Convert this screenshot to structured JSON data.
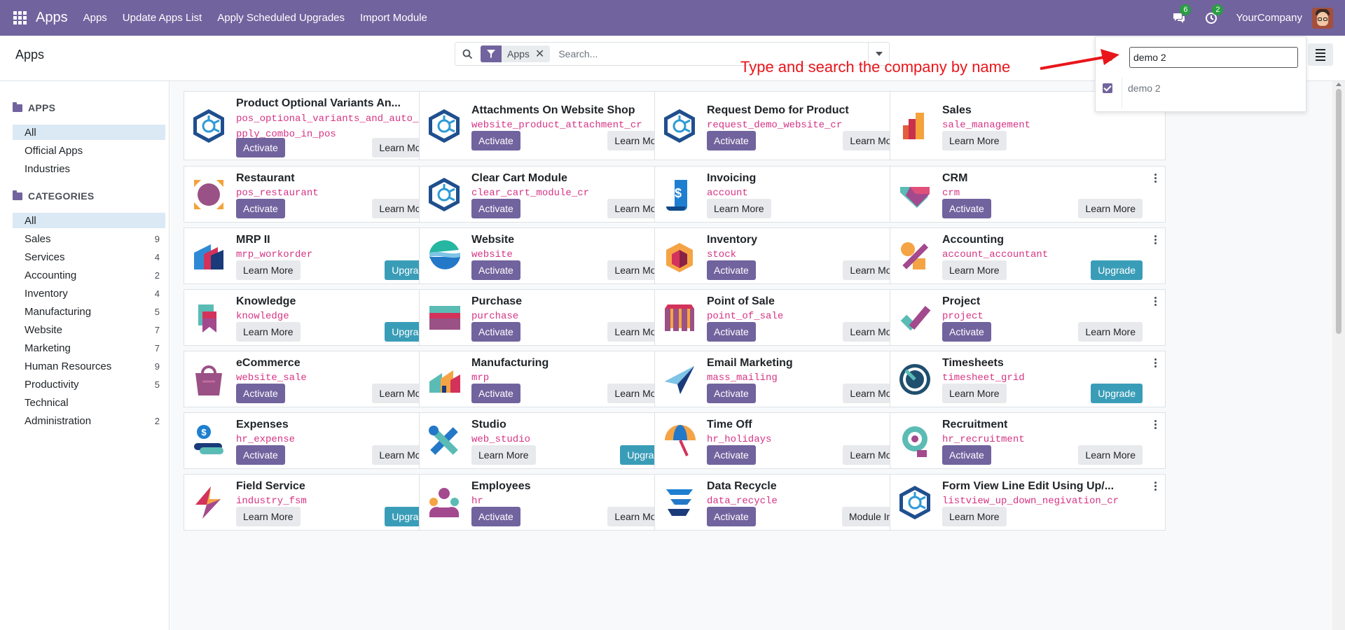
{
  "navbar": {
    "brand": "Apps",
    "menus": [
      "Apps",
      "Update Apps List",
      "Apply Scheduled Upgrades",
      "Import Module"
    ],
    "messages_badge": "6",
    "activities_badge": "2",
    "company": "YourCompany",
    "bg_color": "#71639e"
  },
  "control_panel": {
    "title": "Apps",
    "facet_label": "Apps",
    "search_placeholder": "Search..."
  },
  "company_switcher": {
    "search_value": "demo 2",
    "option": "demo 2",
    "option_checked": true
  },
  "annotation": {
    "text": "Type and search the company by name",
    "color": "#e8161b"
  },
  "sidebar": {
    "apps_header": "APPS",
    "apps_items": [
      {
        "label": "All",
        "active": true
      },
      {
        "label": "Official Apps",
        "active": false
      },
      {
        "label": "Industries",
        "active": false
      }
    ],
    "categories_header": "CATEGORIES",
    "categories": [
      {
        "label": "All",
        "count": "",
        "active": true
      },
      {
        "label": "Sales",
        "count": "9"
      },
      {
        "label": "Services",
        "count": "4"
      },
      {
        "label": "Accounting",
        "count": "2"
      },
      {
        "label": "Inventory",
        "count": "4"
      },
      {
        "label": "Manufacturing",
        "count": "5"
      },
      {
        "label": "Website",
        "count": "7"
      },
      {
        "label": "Marketing",
        "count": "7"
      },
      {
        "label": "Human Resources",
        "count": "9"
      },
      {
        "label": "Productivity",
        "count": "5"
      },
      {
        "label": "Technical",
        "count": ""
      },
      {
        "label": "Administration",
        "count": "2"
      }
    ]
  },
  "apps": [
    {
      "name": "Product Optional Variants An...",
      "tech": "pos_optional_variants_and_auto_apply_combo_in_pos",
      "tech_lines": [
        "pos_optional_variants_and_auto_a",
        "pply_combo_in_pos"
      ],
      "icon": "cybrosys-icon",
      "buttons": [
        "Activate",
        "Learn More"
      ]
    },
    {
      "name": "Attachments On Website Shop",
      "tech": "website_product_attachment_cr",
      "icon": "cybrosys-icon",
      "buttons": [
        "Activate",
        "Learn More"
      ]
    },
    {
      "name": "Request Demo for Product",
      "tech": "request_demo_website_cr",
      "icon": "cybrosys-icon",
      "buttons": [
        "Activate",
        "Learn More"
      ]
    },
    {
      "name": "Sales",
      "tech": "sale_management",
      "icon": "sales-icon",
      "buttons": [
        "Learn More"
      ]
    },
    {
      "name": "Restaurant",
      "tech": "pos_restaurant",
      "icon": "restaurant-icon",
      "buttons": [
        "Activate",
        "Learn More"
      ]
    },
    {
      "name": "Clear Cart Module",
      "tech": "clear_cart_module_cr",
      "icon": "cybrosys-icon",
      "buttons": [
        "Activate",
        "Learn More"
      ]
    },
    {
      "name": "Invoicing",
      "tech": "account",
      "icon": "invoicing-icon",
      "buttons": [
        "Learn More"
      ]
    },
    {
      "name": "CRM",
      "tech": "crm",
      "icon": "crm-icon",
      "buttons": [
        "Activate",
        "Learn More"
      ]
    },
    {
      "name": "MRP II",
      "tech": "mrp_workorder",
      "icon": "mrp-icon",
      "buttons": [
        "Learn More",
        "Upgrade"
      ]
    },
    {
      "name": "Website",
      "tech": "website",
      "icon": "website-icon",
      "buttons": [
        "Activate",
        "Learn More"
      ]
    },
    {
      "name": "Inventory",
      "tech": "stock",
      "icon": "inventory-icon",
      "buttons": [
        "Activate",
        "Learn More"
      ]
    },
    {
      "name": "Accounting",
      "tech": "account_accountant",
      "icon": "accounting-icon",
      "buttons": [
        "Learn More",
        "Upgrade"
      ]
    },
    {
      "name": "Knowledge",
      "tech": "knowledge",
      "icon": "knowledge-icon",
      "buttons": [
        "Learn More",
        "Upgrade"
      ]
    },
    {
      "name": "Purchase",
      "tech": "purchase",
      "icon": "purchase-icon",
      "buttons": [
        "Activate",
        "Learn More"
      ]
    },
    {
      "name": "Point of Sale",
      "tech": "point_of_sale",
      "icon": "point-of-sale-icon",
      "buttons": [
        "Activate",
        "Learn More"
      ]
    },
    {
      "name": "Project",
      "tech": "project",
      "icon": "project-icon",
      "buttons": [
        "Activate",
        "Learn More"
      ]
    },
    {
      "name": "eCommerce",
      "tech": "website_sale",
      "icon": "ecommerce-icon",
      "buttons": [
        "Activate",
        "Learn More"
      ]
    },
    {
      "name": "Manufacturing",
      "tech": "mrp",
      "icon": "manufacturing-icon",
      "buttons": [
        "Activate",
        "Learn More"
      ]
    },
    {
      "name": "Email Marketing",
      "tech": "mass_mailing",
      "icon": "email-marketing-icon",
      "buttons": [
        "Activate",
        "Learn More"
      ]
    },
    {
      "name": "Timesheets",
      "tech": "timesheet_grid",
      "icon": "timesheets-icon",
      "buttons": [
        "Learn More",
        "Upgrade"
      ]
    },
    {
      "name": "Expenses",
      "tech": "hr_expense",
      "icon": "expenses-icon",
      "buttons": [
        "Activate",
        "Learn More"
      ]
    },
    {
      "name": "Studio",
      "tech": "web_studio",
      "icon": "studio-icon",
      "buttons": [
        "Learn More",
        "Upgrade"
      ]
    },
    {
      "name": "Time Off",
      "tech": "hr_holidays",
      "icon": "time-off-icon",
      "buttons": [
        "Activate",
        "Learn More"
      ]
    },
    {
      "name": "Recruitment",
      "tech": "hr_recruitment",
      "icon": "recruitment-icon",
      "buttons": [
        "Activate",
        "Learn More"
      ]
    },
    {
      "name": "Field Service",
      "tech": "industry_fsm",
      "icon": "field-service-icon",
      "buttons": [
        "Learn More",
        "Upgrade"
      ]
    },
    {
      "name": "Employees",
      "tech": "hr",
      "icon": "employees-icon",
      "buttons": [
        "Activate",
        "Learn More"
      ]
    },
    {
      "name": "Data Recycle",
      "tech": "data_recycle",
      "icon": "data-recycle-icon",
      "buttons": [
        "Activate",
        "Module Info"
      ]
    },
    {
      "name": "Form View Line Edit Using Up/...",
      "tech": "listview_up_down_negivation_cr",
      "icon": "cybrosys-icon",
      "buttons": [
        "Learn More"
      ]
    }
  ]
}
